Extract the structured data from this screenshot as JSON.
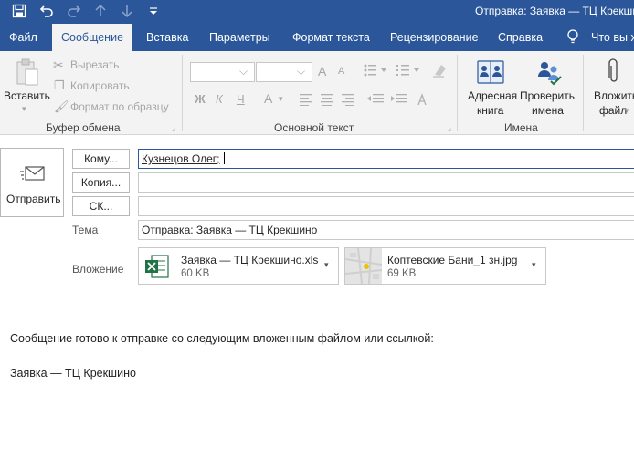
{
  "window": {
    "title": "Отправка: Заявка — ТЦ Крекшино"
  },
  "tabs": [
    {
      "label": "Файл"
    },
    {
      "label": "Сообщение"
    },
    {
      "label": "Вставка"
    },
    {
      "label": "Параметры"
    },
    {
      "label": "Формат текста"
    },
    {
      "label": "Рецензирование"
    },
    {
      "label": "Справка"
    },
    {
      "label": "Что вы х"
    }
  ],
  "ribbon": {
    "clipboard": {
      "paste": "Вставить",
      "cut": "Вырезать",
      "copy": "Копировать",
      "format_painter": "Формат по образцу",
      "group": "Буфер обмена"
    },
    "basic_text": {
      "group": "Основной текст",
      "bold": "Ж",
      "italic": "К",
      "underline": "Ч",
      "font_color": "А",
      "grow": "A",
      "shrink": "A"
    },
    "names": {
      "address_book_1": "Адресная",
      "address_book_2": "книга",
      "check_1": "Проверить",
      "check_2": "имена",
      "group": "Имена"
    },
    "attach": {
      "line1": "Вложить",
      "line2": "файл"
    }
  },
  "compose": {
    "send": "Отправить",
    "to_btn": "Кому...",
    "cc_btn": "Копия...",
    "bcc_btn": "СК...",
    "to_value": "Кузнецов Олег;",
    "cc_value": "",
    "bcc_value": "",
    "subject_label": "Тема",
    "subject_value": "Отправка: Заявка — ТЦ Крекшино",
    "attachment_label": "Вложение",
    "attachments": [
      {
        "name": "Заявка — ТЦ Крекшино.xls",
        "size": "60 KB"
      },
      {
        "name": "Коптевские Бани_1 зн.jpg",
        "size": "69 KB"
      }
    ]
  },
  "body": {
    "line1": "Сообщение готово к отправке со следующим вложенным файлом или ссылкой:",
    "line2": "Заявка — ТЦ Крекшино"
  },
  "colors": {
    "accent": "#2b579a",
    "ribbon": "#f3f3f3",
    "excel": "#217346"
  }
}
